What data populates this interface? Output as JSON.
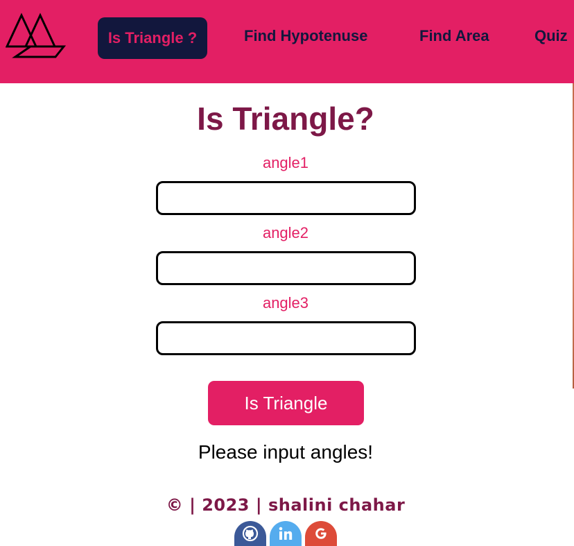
{
  "nav": {
    "items": [
      {
        "label": "Is Triangle ?",
        "active": true
      },
      {
        "label": "Find Hypotenuse"
      },
      {
        "label": "Find Area"
      },
      {
        "label": "Quiz"
      }
    ]
  },
  "main": {
    "title": "Is Triangle?",
    "fields": [
      {
        "label": "angle1",
        "value": ""
      },
      {
        "label": "angle2",
        "value": ""
      },
      {
        "label": "angle3",
        "value": ""
      }
    ],
    "button_label": "Is Triangle",
    "message": "Please input angles!"
  },
  "footer": {
    "text": "© | 2023 | shalini chahar",
    "social": [
      {
        "name": "github-icon",
        "color": "#3b5998"
      },
      {
        "name": "linkedin-icon",
        "color": "#55acee"
      },
      {
        "name": "google-icon",
        "color": "#dd4b39"
      }
    ]
  },
  "colors": {
    "accent": "#e31f64",
    "navy": "#12173d",
    "maroon": "#7d1847"
  }
}
